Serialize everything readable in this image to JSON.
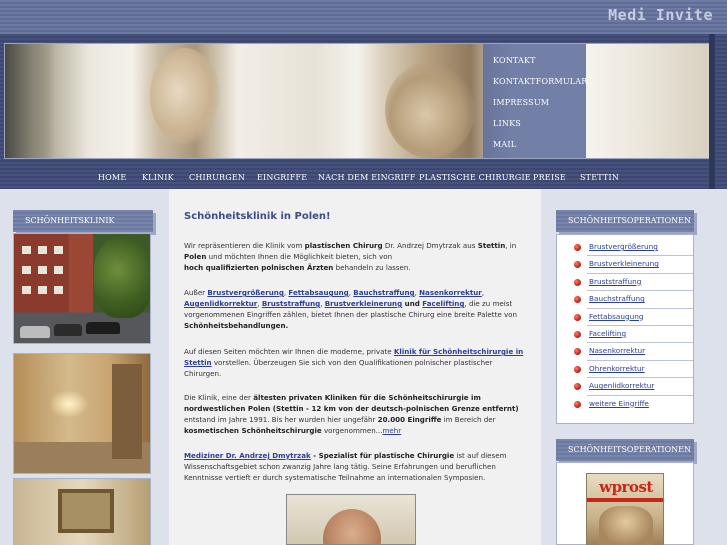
{
  "brand": "Medi Invite",
  "submenu": [
    "KONTAKT",
    "KONTAKTFORMULAR",
    "IMPRESSUM",
    "LINKS",
    "MAIL"
  ],
  "nav": [
    "HOME",
    "KLINIK",
    "CHIRURGEN",
    "EINGRIFFE",
    "NACH DEM EINGRIFF",
    "PLASTISCHE CHIRURGIE",
    "PREISE",
    "STETTIN"
  ],
  "left": {
    "title": "SCHÖNHEITSKLINIK"
  },
  "main": {
    "title": "Schönheitsklinik in Polen!",
    "p1": {
      "t1": "Wir repräsentieren die Klinik vom ",
      "b1": "plastischen Chirurg",
      "t2": " Dr. Andrzej Dmytrzak aus ",
      "b2": "Stettin",
      "t3": ", in ",
      "b3": "Polen",
      "t4": " und möchten Ihnen die Möglichkeit bieten, sich von ",
      "b4": "hoch qualifizierten polnischen Ärzten",
      "t5": " behandeln zu lassen."
    },
    "p2": {
      "t1": "Außer ",
      "links": [
        "Brustvergrößerung",
        "Fettabsaugung",
        "Bauchstraffung",
        "Nasenkorrektur",
        "Augenlidkorrektur",
        "Bruststraffung",
        "Brustverkleinerung"
      ],
      "and": " und ",
      "last": "Facelifting",
      "t2": ", die zu meist vorgenommenen Eingriffen zählen, bietet Ihnen der plastische Chirurg eine breite Palette von ",
      "b1": "Schönheitsbehandlungen."
    },
    "p3": {
      "t1": "Auf diesen Seiten möchten wir Ihnen die moderne, private ",
      "link": "Klinik für Schönheitschirurgie in Stettin",
      "t2": " vorstellen. Überzeugen Sie sich von den Qualifikationen polnischer plastischer Chirurgen."
    },
    "p4": {
      "t1": "Die Klinik, eine der ",
      "b1": "ältesten privaten Kliniken für die Schönheitschirurgie im nordwestlichen Polen (Stettin - 12 km von der deutsch-polnischen Grenze entfernt)",
      "t2": " entstand im Jahre 1991. Bis her wurden hier ungefähr ",
      "b2": "20.000 Eingriffe",
      "t3": " im Bereich der ",
      "b3": "kosmetischen Schönheitschirurgie",
      "t4": " vorgenommen...",
      "more": "mehr"
    },
    "p5": {
      "link": "Mediziner Dr. Andrzej Dmytrzak",
      "b1": " - Spezialist für plastische Chirurgie",
      "t1": " ist auf diesem Wissenschaftsgebiet schon zwanzig Jahre lang tätig. Seine Erfahrungen und beruflichen Kenntnisse vertieft er durch systematische Teilnahme an internationalen Symposien."
    }
  },
  "right": {
    "title1": "SCHÖNHEITSOPERATIONEN",
    "operations": [
      "Brustvergrößerung",
      "Brustverkleinerung",
      "Bruststraffung",
      "Bauchstraffung",
      "Fettabsaugung",
      "Facelifting",
      "Nasenkorrektur",
      "Ohrenkorrektur",
      "Augenlidkorrektur",
      "weitere Eingriffe"
    ],
    "title2": "SCHÖNHEITSOPERATIONEN",
    "magazine_title": "wprost"
  }
}
